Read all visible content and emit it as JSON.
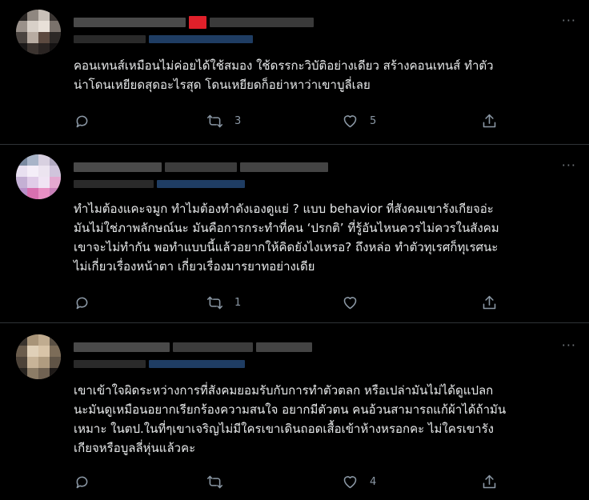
{
  "colors": {
    "background": "#000000",
    "divider": "#2f3336",
    "text": "#e7e9ea",
    "icon": "#8b98a5",
    "pixel_red": "#e0202a",
    "pixel_blue": "#1f3d63"
  },
  "icons": {
    "reply": "speech-bubble",
    "retweet": "retweet-arrows",
    "like": "heart",
    "share": "upload-arrow",
    "more": "three-dots"
  },
  "tweets": [
    {
      "more": "···",
      "text": "คอนเทนส์เหมือนไม่ค่อยได้ใช้สมอง ใช้ดรรกะวิบัติอย่างเดียว สร้างคอนเทนส์  ทำตัว\nน่าโดนเหยียดสุดอะไรสุด โดนเหยียดก็อย่าหาว่าเขาบูลี่เลย",
      "retweets": "3",
      "likes": "5"
    },
    {
      "more": "···",
      "text": "ทำไมต้องแคะจมูก ทำไมต้องทำดังเองดูแย่ ? แบบ behavior ที่สังคมเขารังเกียจอ่ะ\nมันไม่ใช่ภาพลักษณ์นะ มันคือการกระทำที่คน ‘ปรกติ’ ที่รู้อันไหนควรไม่ควรในสังคม\nเขาจะไม่ทำกัน พอทำแบบนี้แล้วอยากให้คิดยังไงเหรอ? ถึงหล่อ ทำตัวทุเรศก็ทุเรศนะ\nไม่เกี่ยวเรื่องหน้าตา เกี่ยวเรื่องมารยาทอย่างเดีย",
      "retweets": "1",
      "likes": ""
    },
    {
      "more": "···",
      "text": "เขาเข้าใจผิดระหว่างการที่สังคมยอมรับกับการทำตัวตลก หรือเปล่ามันไม่ได้ดูแปลก\nนะมันดูเหมือนอยากเรียกร้องความสนใจ อยากมีตัวตน คนอ้วนสามารถแก้ผ้าได้ถ้ามัน\nเหมาะ ในตป.ในที่ๆเขาเจริญไม่มีใครเขาเดินถอดเสื้อเข้าห้างหรอกคะ ไม่ใครเขารัง\nเกียจหรือบูลลี่หุ่นแล้วคะ",
      "retweets": "",
      "likes": "4"
    }
  ]
}
